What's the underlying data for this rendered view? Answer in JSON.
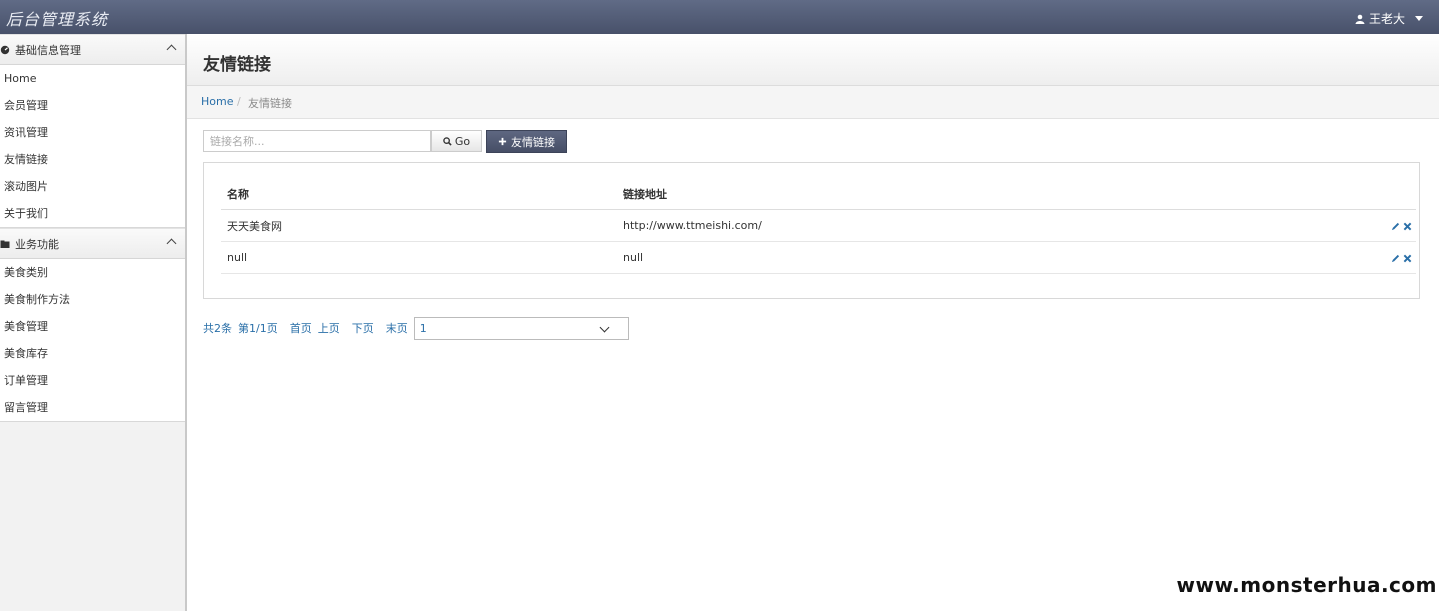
{
  "app": {
    "brand": "后台管理系统",
    "user_name": "王老大"
  },
  "sidebar": {
    "sections": [
      {
        "title": "基础信息管理",
        "items": [
          "Home",
          "会员管理",
          "资讯管理",
          "友情链接",
          "滚动图片",
          "关于我们"
        ]
      },
      {
        "title": "业务功能",
        "items": [
          "美食类别",
          "美食制作方法",
          "美食管理",
          "美食库存",
          "订单管理",
          "留言管理"
        ]
      }
    ]
  },
  "page": {
    "title": "友情链接",
    "breadcrumb": {
      "home": "Home",
      "separator": "/",
      "current": "友情链接"
    }
  },
  "toolbar": {
    "search_placeholder": "链接名称...",
    "go_label": "Go",
    "add_label": "友情链接"
  },
  "table": {
    "headers": [
      "名称",
      "链接地址"
    ],
    "rows": [
      {
        "name": "天天美食网",
        "url": "http://www.ttmeishi.com/"
      },
      {
        "name": "null",
        "url": "null"
      }
    ]
  },
  "pager": {
    "total": "共2条",
    "page_info": "第1/1页",
    "first": "首页",
    "prev": "上页",
    "next": "下页",
    "last": "末页",
    "selected_page": "1"
  },
  "watermark": "www.monsterhua.com",
  "colors": {
    "topbar": "#525b75",
    "link": "#2a6fa8",
    "action_icon": "#2a6fa8"
  }
}
